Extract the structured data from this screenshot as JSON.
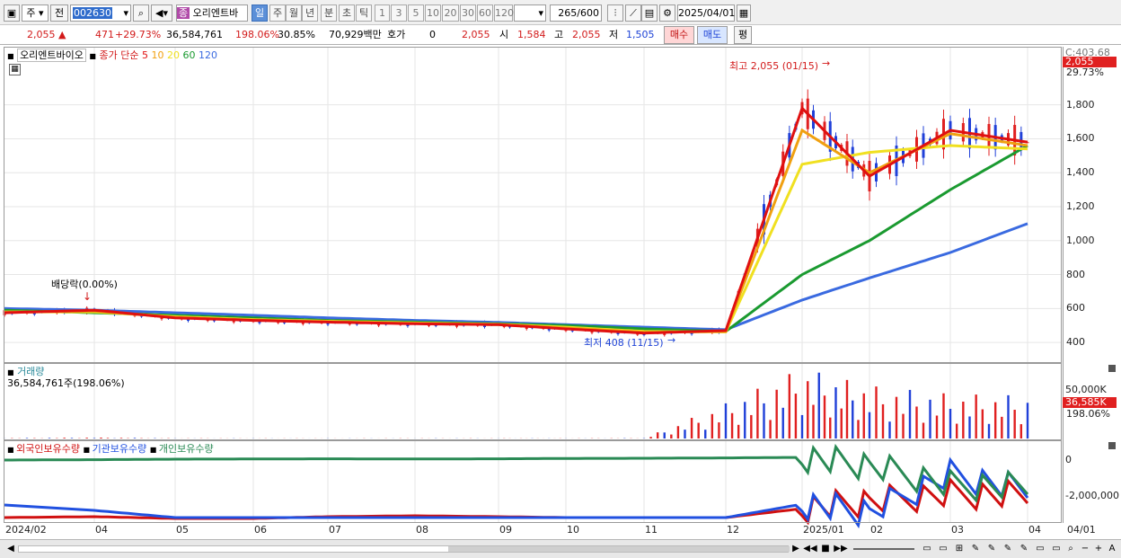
{
  "toolbar": {
    "market_type": "주",
    "prev_label": "전",
    "code": "002630",
    "name_badge": "종",
    "stock_name": "오리엔트바",
    "periods": [
      "일",
      "주",
      "월",
      "년",
      "분",
      "초",
      "틱"
    ],
    "active_period": "일",
    "intervals": [
      "1",
      "3",
      "5",
      "10",
      "20",
      "30",
      "60",
      "120"
    ],
    "count": "265",
    "count_total": "/600",
    "date": "2025/04/01"
  },
  "quote": {
    "price": "2,055",
    "change": "471",
    "change_pct": "+29.73%",
    "volume": "36,584,761",
    "volume_ratio": "198.06%",
    "turnover": "30.85%",
    "amount": "70,929백만",
    "hoga_label": "호가",
    "hoga_value": "0",
    "hoga_price": "2,055",
    "open_label": "시",
    "open": "1,584",
    "high_label": "고",
    "high": "2,055",
    "low_label": "저",
    "low": "1,505",
    "buy_label": "매수",
    "sell_label": "매도",
    "avg_label": "평"
  },
  "price_panel": {
    "stock_label": "오리엔트바이오",
    "ma_title": "종가 단순",
    "ma_periods": [
      {
        "label": "5",
        "color": "#e01010"
      },
      {
        "label": "10",
        "color": "#f0a010"
      },
      {
        "label": "20",
        "color": "#f0e020"
      },
      {
        "label": "60",
        "color": "#1a9a30"
      },
      {
        "label": "120",
        "color": "#3a6ae0"
      }
    ],
    "dividend_note": "배당락(0.00%)",
    "high_note": "최고 2,055 (01/15)",
    "low_note": "최저 408 (11/15)",
    "axis_top_label": "C:403.68",
    "current_price_tag": "2,055",
    "current_pct_tag": "29.73%",
    "y_ticks": [
      "1,800",
      "1,600",
      "1,400",
      "1,200",
      "1,000",
      "800",
      "600",
      "400"
    ]
  },
  "volume_panel": {
    "title": "거래량",
    "value_line": "36,584,761주(198.06%)",
    "y_tick": "50,000K",
    "current_tag": "36,585K",
    "current_pct": "198.06%"
  },
  "holdings_panel": {
    "series": [
      {
        "name": "외국인보유수량",
        "color": "#d01010"
      },
      {
        "name": "기관보유수량",
        "color": "#2050e0"
      },
      {
        "name": "개인보유수량",
        "color": "#2a8a55"
      }
    ],
    "y_ticks": [
      "0",
      "-2,000,000"
    ]
  },
  "x_axis": {
    "labels": [
      "2024/02",
      "04",
      "05",
      "06",
      "07",
      "08",
      "09",
      "10",
      "11",
      "12",
      "2025/01",
      "02",
      "03",
      "04"
    ],
    "right_label": "04/01"
  },
  "chart_data": [
    {
      "type": "line",
      "title": "",
      "x": [
        "2024/02",
        "04",
        "05",
        "06",
        "07",
        "08",
        "09",
        "10",
        "11",
        "12",
        "2025/01",
        "02",
        "03",
        "04"
      ],
      "series": [
        {
          "name": "5",
          "values": [
            575,
            590,
            545,
            530,
            520,
            510,
            505,
            480,
            455,
            470,
            1780,
            1380,
            1650,
            1580
          ]
        },
        {
          "name": "10",
          "values": [
            578,
            585,
            548,
            532,
            522,
            512,
            505,
            485,
            460,
            465,
            1650,
            1400,
            1630,
            1560
          ]
        },
        {
          "name": "20",
          "values": [
            580,
            580,
            552,
            535,
            525,
            515,
            507,
            490,
            465,
            462,
            1450,
            1520,
            1560,
            1540
          ]
        },
        {
          "name": "60",
          "values": [
            590,
            575,
            560,
            545,
            530,
            520,
            510,
            500,
            480,
            465,
            800,
            1000,
            1300,
            1560
          ]
        },
        {
          "name": "120",
          "values": [
            600,
            590,
            575,
            560,
            545,
            530,
            518,
            505,
            490,
            475,
            650,
            780,
            930,
            1100
          ]
        }
      ],
      "ylim": [
        300,
        2100
      ]
    },
    {
      "type": "bar",
      "title": "거래량",
      "categories": [
        "2024/02",
        "04",
        "05",
        "06",
        "07",
        "08",
        "09",
        "10",
        "11",
        "12",
        "2025/01",
        "02",
        "03",
        "04"
      ],
      "values": [
        300,
        800,
        200,
        150,
        120,
        180,
        160,
        140,
        300,
        30000,
        60000,
        45000,
        38000,
        36585
      ],
      "ylim": [
        0,
        70000
      ]
    },
    {
      "type": "line",
      "title": "",
      "x": [
        "2024/02",
        "04",
        "05",
        "06",
        "07",
        "08",
        "09",
        "10",
        "11",
        "12",
        "2025/01",
        "02",
        "03",
        "04"
      ],
      "series": [
        {
          "name": "외국인보유수량",
          "values": [
            -3200000,
            -3150000,
            -3250000,
            -3250000,
            -3150000,
            -3100000,
            -3150000,
            -3200000,
            -3200000,
            -3200000,
            -2700000,
            -2300000,
            -1900000,
            -2000000
          ]
        },
        {
          "name": "기관보유수량",
          "values": [
            -2500000,
            -2800000,
            -3200000,
            -3200000,
            -3200000,
            -3200000,
            -3200000,
            -3200000,
            -3200000,
            -3200000,
            -2450000,
            -2900000,
            -800000,
            -1700000
          ]
        },
        {
          "name": "개인보유수량",
          "values": [
            0,
            20000,
            50000,
            60000,
            70000,
            60000,
            70000,
            90000,
            100000,
            120000,
            150000,
            -300000,
            -1400000,
            -1500000
          ]
        }
      ],
      "ylim": [
        -3400000,
        500000
      ]
    }
  ],
  "bottom": {
    "scroll_left": "◀",
    "scroll_right": "▶"
  }
}
